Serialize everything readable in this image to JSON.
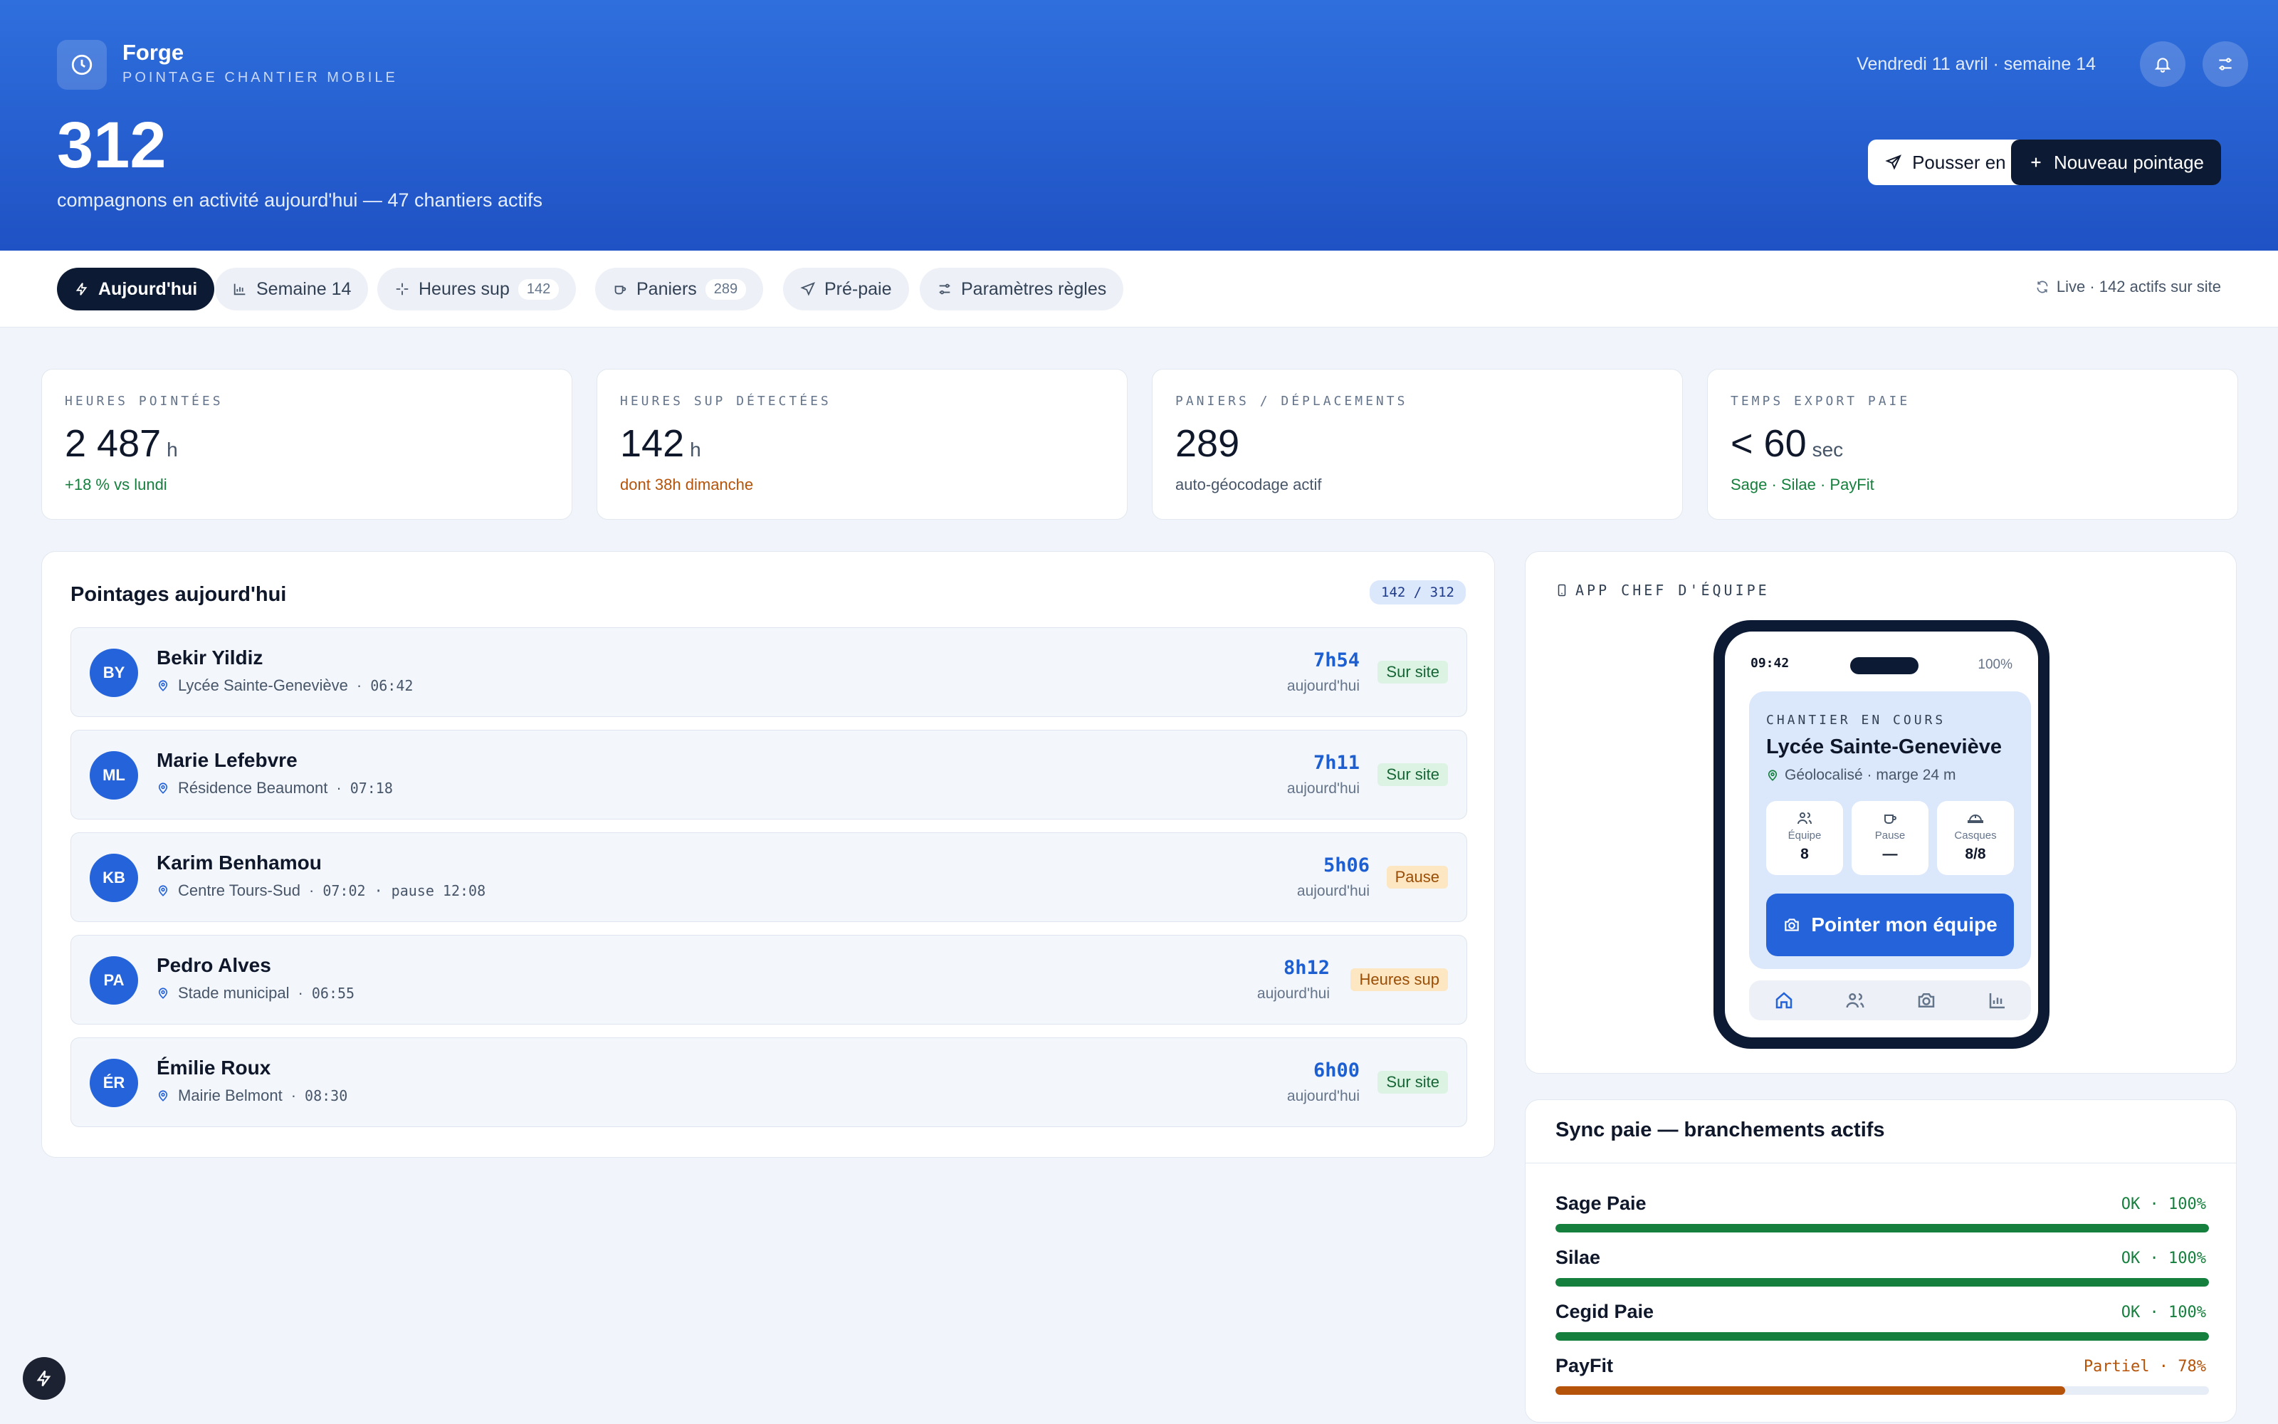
{
  "brand": {
    "name": "Forge",
    "subtitle": "POINTAGE CHANTIER MOBILE"
  },
  "header": {
    "date": "Vendredi 11 avril · semaine 14",
    "icons": [
      "bell-icon",
      "sliders-icon"
    ]
  },
  "hero": {
    "count": "312",
    "subtitle": "compagnons en activité aujourd'hui — 47 chantiers actifs"
  },
  "actions": {
    "push_label": "Pousser en paie",
    "new_label": "Nouveau pointage"
  },
  "tabs": [
    {
      "label": "Aujourd'hui",
      "icon": "bolt-icon",
      "active": true
    },
    {
      "label": "Semaine 14",
      "icon": "chart-icon"
    },
    {
      "label": "Heures sup",
      "icon": "sparkle-icon",
      "count": "142"
    },
    {
      "label": "Paniers",
      "icon": "cup-icon",
      "count": "289"
    },
    {
      "label": "Pré-paie",
      "icon": "send-icon"
    },
    {
      "label": "Paramètres règles",
      "icon": "sliders-icon"
    }
  ],
  "live": "Live · 142 actifs sur site",
  "kpis": [
    {
      "label": "HEURES POINTÉES",
      "value": "2 487",
      "unit": "h",
      "sub": "+18 % vs lundi"
    },
    {
      "label": "HEURES SUP DÉTECTÉES",
      "value": "142",
      "unit": "h",
      "sub": "dont 38h dimanche"
    },
    {
      "label": "PANIERS / DÉPLACEMENTS",
      "value": "289",
      "unit": "",
      "sub": "auto-géocodage actif"
    },
    {
      "label": "TEMPS EXPORT PAIE",
      "value": "< 60",
      "unit": "sec",
      "sub": "Sage · Silae · PayFit"
    }
  ],
  "pointages": {
    "title": "Pointages aujourd'hui",
    "ratio": "142 / 312",
    "rows": [
      {
        "initials": "BY",
        "name": "Bekir Yildiz",
        "site": "Lycée Sainte-Geneviève",
        "detail": "06:42",
        "duration": "7h54",
        "today": "aujourd'hui",
        "status": "Sur site"
      },
      {
        "initials": "ML",
        "name": "Marie Lefebvre",
        "site": "Résidence Beaumont",
        "detail": "07:18",
        "duration": "7h11",
        "today": "aujourd'hui",
        "status": "Sur site"
      },
      {
        "initials": "KB",
        "name": "Karim Benhamou",
        "site": "Centre Tours-Sud",
        "detail": "07:02 · pause 12:08",
        "duration": "5h06",
        "today": "aujourd'hui",
        "status": "Pause"
      },
      {
        "initials": "PA",
        "name": "Pedro Alves",
        "site": "Stade municipal",
        "detail": "06:55",
        "duration": "8h12",
        "today": "aujourd'hui",
        "status": "Heures sup"
      },
      {
        "initials": "ÉR",
        "name": "Émilie Roux",
        "site": "Mairie Belmont",
        "detail": "08:30",
        "duration": "6h00",
        "today": "aujourd'hui",
        "status": "Sur site"
      }
    ]
  },
  "phone_app": {
    "label": "APP CHEF D'ÉQUIPE",
    "time": "09:42",
    "battery": "100%",
    "site_label": "CHANTIER EN COURS",
    "site_name": "Lycée Sainte-Geneviève",
    "geo": "Géolocalisé · marge 24 m",
    "stats": [
      {
        "label": "Équipe",
        "value": "8",
        "icon": "users-icon"
      },
      {
        "label": "Pause",
        "value": "—",
        "icon": "cup-icon"
      },
      {
        "label": "Casques",
        "value": "8/8",
        "icon": "helmet-icon"
      }
    ],
    "button": "Pointer mon équipe",
    "nav_icons": [
      "home-icon",
      "users-icon",
      "camera-icon",
      "chart-icon"
    ]
  },
  "sync": {
    "title": "Sync paie — branchements actifs",
    "items": [
      {
        "name": "Sage Paie",
        "status": "OK · 100%",
        "progress": 1.0,
        "color": "#15803d"
      },
      {
        "name": "Silae",
        "status": "OK · 100%",
        "progress": 1.0,
        "color": "#15803d"
      },
      {
        "name": "Cegid Paie",
        "status": "OK · 100%",
        "progress": 1.0,
        "color": "#15803d"
      },
      {
        "name": "PayFit",
        "status": "Partiel · 78%",
        "progress": 0.78,
        "color": "#b45309"
      }
    ]
  },
  "colors": {
    "primary": "#2563db",
    "dark": "#0c1a33",
    "success": "#15803d",
    "warning": "#b45309"
  }
}
